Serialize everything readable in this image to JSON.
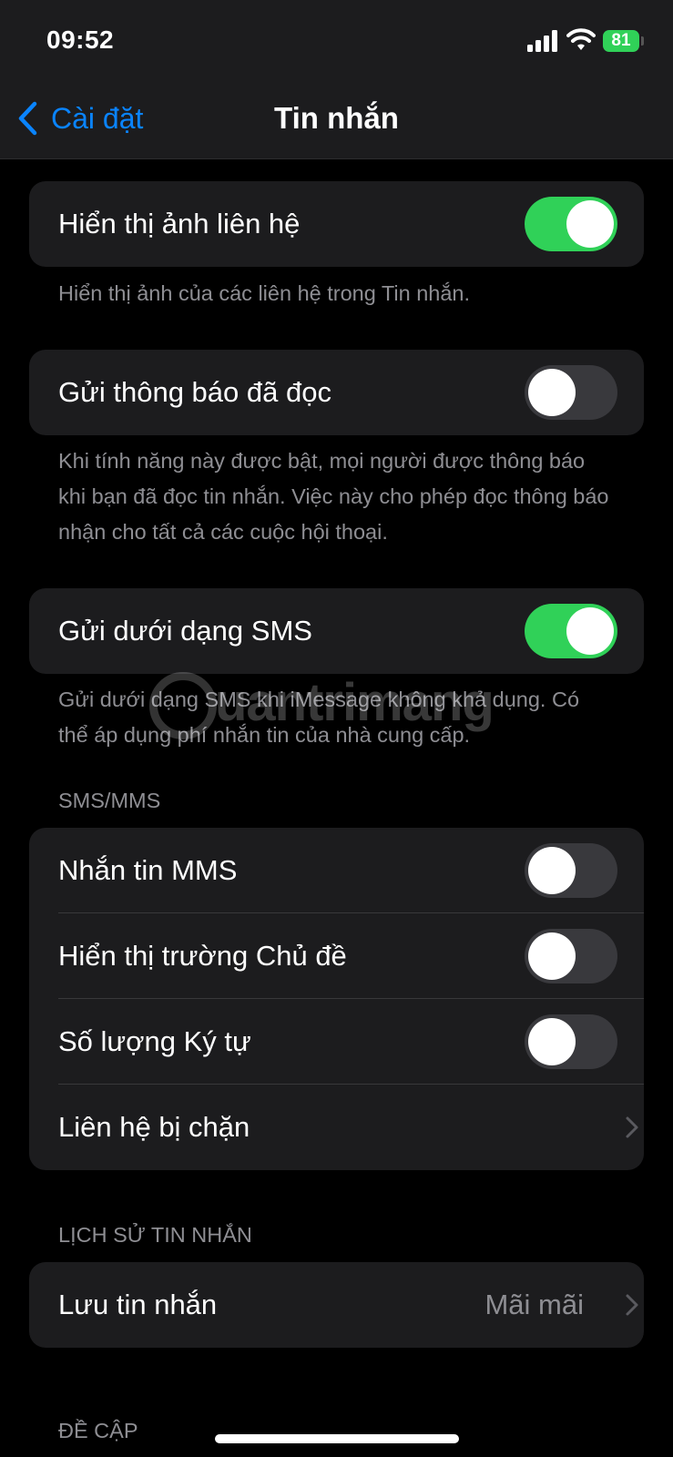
{
  "status_bar": {
    "time": "09:52",
    "battery": "81"
  },
  "nav": {
    "back_label": "Cài đặt",
    "title": "Tin nhắn"
  },
  "contact_photos": {
    "label": "Hiển thị ảnh liên hệ",
    "on": true,
    "footer": "Hiển thị ảnh của các liên hệ trong Tin nhắn."
  },
  "read_receipts": {
    "label": "Gửi thông báo đã đọc",
    "on": false,
    "footer": "Khi tính năng này được bật, mọi người được thông báo khi bạn đã đọc tin nhắn. Việc này cho phép đọc thông báo nhận cho tất cả các cuộc hội thoại."
  },
  "send_as_sms": {
    "label": "Gửi dưới dạng SMS",
    "on": true,
    "footer": "Gửi dưới dạng SMS khi iMessage không khả dụng. Có thể áp dụng phí nhắn tin của nhà cung cấp."
  },
  "sms_mms": {
    "header": "SMS/MMS",
    "rows": [
      {
        "label": "Nhắn tin MMS",
        "on": false
      },
      {
        "label": "Hiển thị trường Chủ đề",
        "on": false
      },
      {
        "label": "Số lượng Ký tự",
        "on": false
      },
      {
        "label": "Liên hệ bị chặn"
      }
    ]
  },
  "message_history": {
    "header": "LỊCH SỬ TIN NHẮN",
    "keep_messages": {
      "label": "Lưu tin nhắn",
      "value": "Mãi mãi"
    }
  },
  "next_header": "ĐỀ CẬP",
  "watermark": "uantrimang",
  "colors": {
    "accent": "#0a84ff",
    "toggle_on": "#30d158",
    "toggle_off": "#39393d",
    "group_bg": "#1c1c1e",
    "secondary_text": "#8e8e93"
  }
}
